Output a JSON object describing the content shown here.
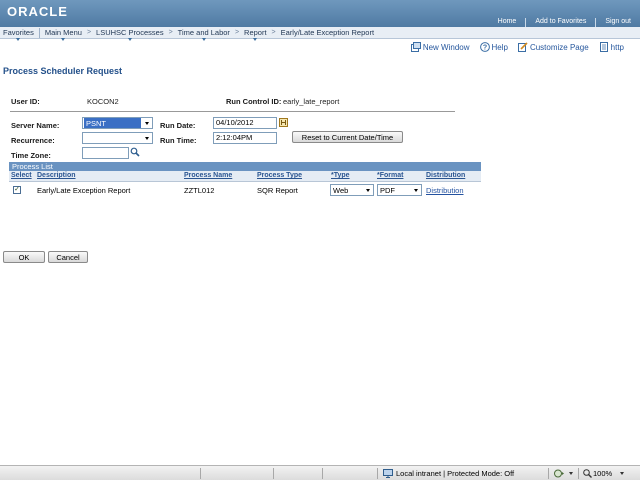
{
  "brand": {
    "logo_text": "ORACLE",
    "accent_color": "#4f7aa3",
    "title_color": "#23508a",
    "link_color": "#2452a0"
  },
  "top_links": [
    "Home",
    "Add to Favorites",
    "Sign out"
  ],
  "nav": {
    "favorites": "Favorites",
    "main_menu": "Main Menu",
    "crumbs": [
      "LSUHSC Processes",
      "Time and Labor",
      "Report",
      "Early/Late Exception Report"
    ],
    "separator": ">"
  },
  "utility": {
    "new_window": "New Window",
    "help": "Help",
    "customize_page": "Customize Page",
    "http": "http"
  },
  "page_title": "Process Scheduler Request",
  "form": {
    "user_id_label": "User ID:",
    "user_id_value": "KOCON2",
    "run_control_label": "Run Control ID:",
    "run_control_value": "early_late_report",
    "server_name_label": "Server Name:",
    "server_name_value": "PSNT",
    "recurrence_label": "Recurrence:",
    "recurrence_value": "",
    "time_zone_label": "Time Zone:",
    "time_zone_value": "",
    "run_date_label": "Run Date:",
    "run_date_value": "04/10/2012",
    "run_time_label": "Run Time:",
    "run_time_value": "2:12:04PM",
    "reset_button": "Reset to Current Date/Time"
  },
  "process_list": {
    "title": "Process List",
    "columns": [
      "Select",
      "Description",
      "Process Name",
      "Process Type",
      "*Type",
      "*Format",
      "Distribution"
    ],
    "rows": [
      {
        "selected": true,
        "description": "Early/Late Exception Report",
        "process_name": "ZZTL012",
        "process_type": "SQR Report",
        "type": "Web",
        "format": "PDF",
        "distribution": "Distribution"
      }
    ]
  },
  "buttons": {
    "ok": "OK",
    "cancel": "Cancel"
  },
  "status_bar": {
    "zone": "Local intranet | Protected Mode: Off",
    "zoom": "100%"
  }
}
